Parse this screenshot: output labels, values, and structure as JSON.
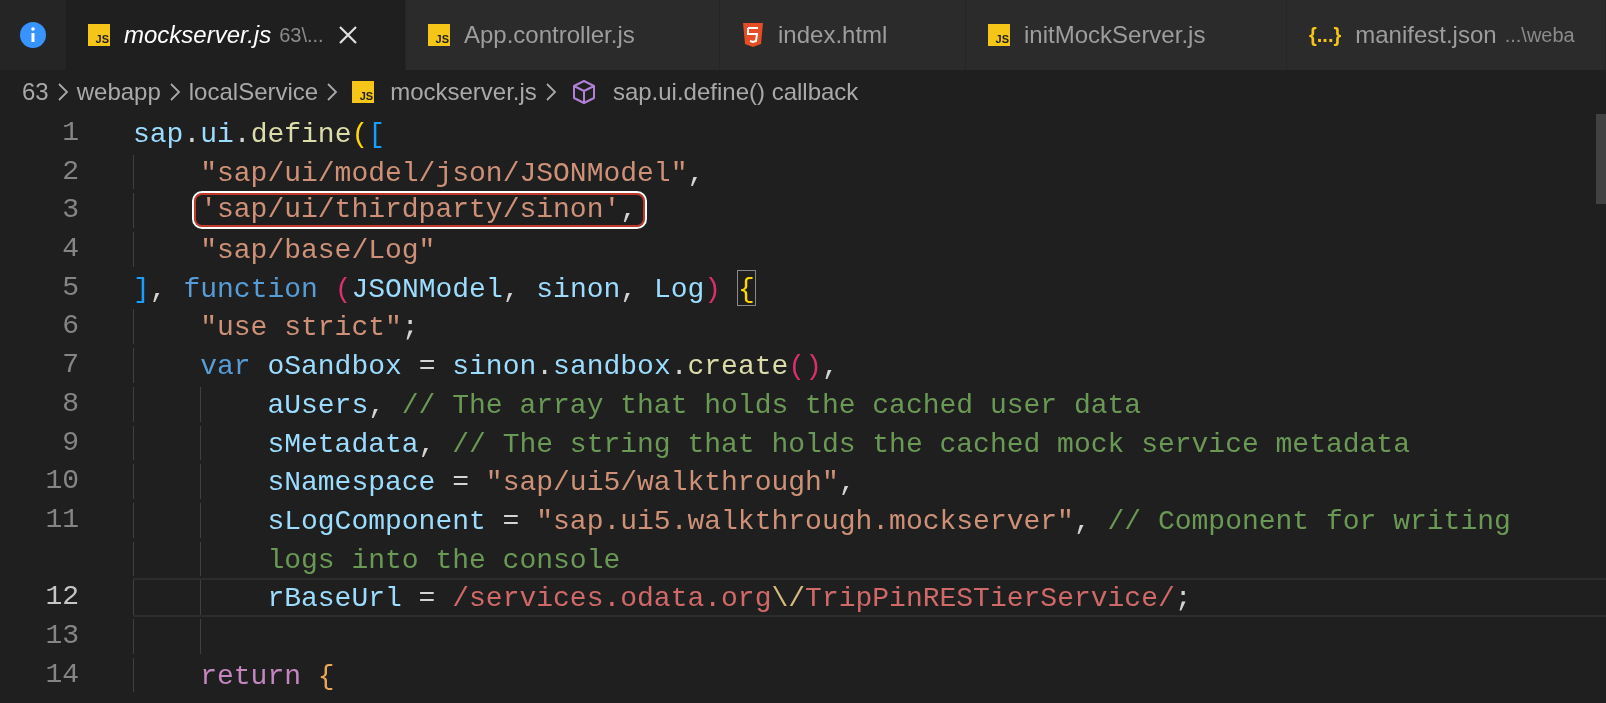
{
  "tabs": [
    {
      "kind": "info",
      "selected": false
    },
    {
      "kind": "js",
      "icon_label": "JS",
      "label": "mockserver.js",
      "description": "63\\...",
      "selected": true,
      "preview": true
    },
    {
      "kind": "js",
      "icon_label": "JS",
      "label": "App.controller.js",
      "selected": false,
      "preview": false
    },
    {
      "kind": "html",
      "label": "index.html",
      "selected": false,
      "preview": false
    },
    {
      "kind": "js",
      "icon_label": "JS",
      "label": "initMockServer.js",
      "selected": false,
      "preview": false
    },
    {
      "kind": "json",
      "icon_label": "{...}",
      "label": "manifest.json",
      "description": "...\\weba",
      "selected": false,
      "preview": false
    }
  ],
  "breadcrumb": [
    {
      "kind": "folder",
      "label": "63"
    },
    {
      "kind": "folder",
      "label": "webapp"
    },
    {
      "kind": "folder",
      "label": "localService"
    },
    {
      "kind": "js",
      "icon_label": "JS",
      "label": "mockserver.js"
    },
    {
      "kind": "symbol",
      "label": "sap.ui.define() callback"
    }
  ],
  "editor": {
    "lines": [
      {
        "number": "1",
        "kind": "top",
        "current": false,
        "annotated": false,
        "tokens": [
          {
            "kind": "var",
            "text": "sap"
          },
          {
            "kind": "punct",
            "text": "."
          },
          {
            "kind": "var",
            "text": "ui"
          },
          {
            "kind": "punct",
            "text": "."
          },
          {
            "kind": "fn",
            "text": "define"
          },
          {
            "kind": "gold",
            "text": "("
          },
          {
            "kind": "blue",
            "text": "["
          }
        ]
      },
      {
        "number": "2",
        "kind": "nested",
        "current": false,
        "annotated": false,
        "tokens": [
          {
            "kind": "str",
            "text": "\"sap/ui/model/json/JSONModel\""
          },
          {
            "kind": "punct",
            "text": ","
          }
        ]
      },
      {
        "number": "3",
        "kind": "nested",
        "current": false,
        "annotated": true,
        "tokens": [
          {
            "kind": "str",
            "text": "'sap/ui/thirdparty/sinon'"
          },
          {
            "kind": "punct",
            "text": ","
          }
        ]
      },
      {
        "number": "4",
        "kind": "nested",
        "current": false,
        "annotated": false,
        "tokens": [
          {
            "kind": "str",
            "text": "\"sap/base/Log\""
          }
        ]
      },
      {
        "number": "5",
        "kind": "top",
        "current": false,
        "annotated": false,
        "tokens": [
          {
            "kind": "blue",
            "text": "]"
          },
          {
            "kind": "punct",
            "text": ", "
          },
          {
            "kind": "kw",
            "text": "function "
          },
          {
            "kind": "pink",
            "text": "("
          },
          {
            "kind": "var",
            "text": "JSONModel"
          },
          {
            "kind": "punct",
            "text": ", "
          },
          {
            "kind": "var",
            "text": "sinon"
          },
          {
            "kind": "punct",
            "text": ", "
          },
          {
            "kind": "var",
            "text": "Log"
          },
          {
            "kind": "pink",
            "text": ") "
          },
          {
            "kind": "match",
            "text": "{"
          }
        ]
      },
      {
        "number": "6",
        "kind": "nested",
        "current": false,
        "annotated": false,
        "tokens": [
          {
            "kind": "str",
            "text": "\"use strict\""
          },
          {
            "kind": "punct",
            "text": ";"
          }
        ]
      },
      {
        "number": "7",
        "kind": "nested",
        "current": false,
        "annotated": false,
        "tokens": [
          {
            "kind": "kw",
            "text": "var "
          },
          {
            "kind": "var",
            "text": "oSandbox"
          },
          {
            "kind": "punct",
            "text": " = "
          },
          {
            "kind": "var",
            "text": "sinon"
          },
          {
            "kind": "punct",
            "text": "."
          },
          {
            "kind": "var",
            "text": "sandbox"
          },
          {
            "kind": "punct",
            "text": "."
          },
          {
            "kind": "fn",
            "text": "create"
          },
          {
            "kind": "pink",
            "text": "()"
          },
          {
            "kind": "punct",
            "text": ","
          }
        ]
      },
      {
        "number": "8",
        "kind": "deep",
        "current": false,
        "annotated": false,
        "tokens": [
          {
            "kind": "var",
            "text": "aUsers"
          },
          {
            "kind": "punct",
            "text": ", "
          },
          {
            "kind": "cmt",
            "text": "// The array that holds the cached user data"
          }
        ]
      },
      {
        "number": "9",
        "kind": "deep",
        "current": false,
        "annotated": false,
        "tokens": [
          {
            "kind": "var",
            "text": "sMetadata"
          },
          {
            "kind": "punct",
            "text": ", "
          },
          {
            "kind": "cmt",
            "text": "// The string that holds the cached mock service metadata"
          }
        ]
      },
      {
        "number": "10",
        "kind": "deep",
        "current": false,
        "annotated": false,
        "tokens": [
          {
            "kind": "var",
            "text": "sNamespace"
          },
          {
            "kind": "punct",
            "text": " = "
          },
          {
            "kind": "str",
            "text": "\"sap/ui5/walkthrough\""
          },
          {
            "kind": "punct",
            "text": ","
          }
        ]
      },
      {
        "number": "11",
        "kind": "deep",
        "current": false,
        "annotated": false,
        "tokens": [
          {
            "kind": "var",
            "text": "sLogComponent"
          },
          {
            "kind": "punct",
            "text": " = "
          },
          {
            "kind": "str",
            "text": "\"sap.ui5.walkthrough.mockserver\""
          },
          {
            "kind": "punct",
            "text": ", "
          },
          {
            "kind": "cmt",
            "text": "// Component for writing"
          }
        ]
      },
      {
        "kind": "deep",
        "current": false,
        "annotated": false,
        "tokens": [
          {
            "kind": "cmt",
            "text": "logs into the console"
          }
        ]
      },
      {
        "number": "12",
        "kind": "deep",
        "current": true,
        "annotated": false,
        "tokens": [
          {
            "kind": "var",
            "text": "rBaseUrl"
          },
          {
            "kind": "punct",
            "text": " = "
          },
          {
            "kind": "regex",
            "text": "/services.odata.org"
          },
          {
            "kind": "esc",
            "text": "\\/"
          },
          {
            "kind": "regex",
            "text": "TripPinRESTierService/"
          },
          {
            "kind": "punct",
            "text": ";"
          }
        ]
      },
      {
        "number": "13",
        "kind": "deep",
        "current": false
      },
      {
        "number": "14",
        "kind": "nested",
        "current": false,
        "annotated": false,
        "tokens": [
          {
            "kind": "ctrl",
            "text": "return "
          },
          {
            "kind": "gold2",
            "text": "{"
          }
        ]
      }
    ]
  }
}
